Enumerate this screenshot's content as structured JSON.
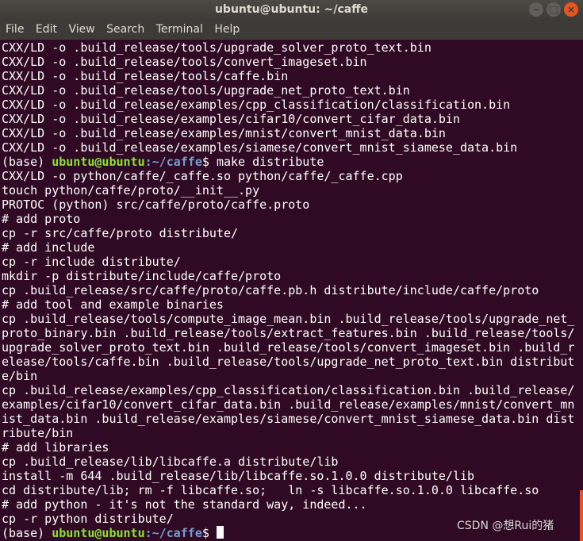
{
  "window": {
    "title": "ubuntu@ubuntu: ~/caffe"
  },
  "controls": {
    "minimize": "−",
    "maximize": "□",
    "close": "×"
  },
  "menu": [
    "File",
    "Edit",
    "View",
    "Search",
    "Terminal",
    "Help"
  ],
  "terminal": {
    "lines": [
      "CXX/LD -o .build_release/tools/upgrade_solver_proto_text.bin",
      "CXX/LD -o .build_release/tools/convert_imageset.bin",
      "CXX/LD -o .build_release/tools/caffe.bin",
      "CXX/LD -o .build_release/tools/upgrade_net_proto_text.bin",
      "CXX/LD -o .build_release/examples/cpp_classification/classification.bin",
      "CXX/LD -o .build_release/examples/cifar10/convert_cifar_data.bin",
      "CXX/LD -o .build_release/examples/mnist/convert_mnist_data.bin",
      "CXX/LD -o .build_release/examples/siamese/convert_mnist_siamese_data.bin",
      "CXX/LD -o python/caffe/_caffe.so python/caffe/_caffe.cpp",
      "touch python/caffe/proto/__init__.py",
      "PROTOC (python) src/caffe/proto/caffe.proto",
      "# add proto",
      "cp -r src/caffe/proto distribute/",
      "# add include",
      "cp -r include distribute/",
      "mkdir -p distribute/include/caffe/proto",
      "cp .build_release/src/caffe/proto/caffe.pb.h distribute/include/caffe/proto",
      "# add tool and example binaries",
      "cp .build_release/tools/compute_image_mean.bin .build_release/tools/upgrade_net_",
      "proto_binary.bin .build_release/tools/extract_features.bin .build_release/tools/",
      "upgrade_solver_proto_text.bin .build_release/tools/convert_imageset.bin .build_r",
      "elease/tools/caffe.bin .build_release/tools/upgrade_net_proto_text.bin distribut",
      "e/bin",
      "cp .build_release/examples/cpp_classification/classification.bin .build_release/",
      "examples/cifar10/convert_cifar_data.bin .build_release/examples/mnist/convert_mn",
      "ist_data.bin .build_release/examples/siamese/convert_mnist_siamese_data.bin dist",
      "ribute/bin",
      "# add libraries",
      "cp .build_release/lib/libcaffe.a distribute/lib",
      "install -m 644 .build_release/lib/libcaffe.so.1.0.0 distribute/lib",
      "cd distribute/lib; rm -f libcaffe.so;   ln -s libcaffe.so.1.0.0 libcaffe.so",
      "# add python - it's not the standard way, indeed...",
      "cp -r python distribute/"
    ],
    "prompt1": {
      "env": "(base) ",
      "user": "ubuntu@ubuntu",
      "path": ":~/caffe",
      "suffix": "$ ",
      "command": "make distribute"
    },
    "prompt2": {
      "env": "(base) ",
      "user": "ubuntu@ubuntu",
      "path": ":~/caffe",
      "suffix": "$ ",
      "command": ""
    }
  },
  "watermark": "CSDN @想Rui的猪"
}
